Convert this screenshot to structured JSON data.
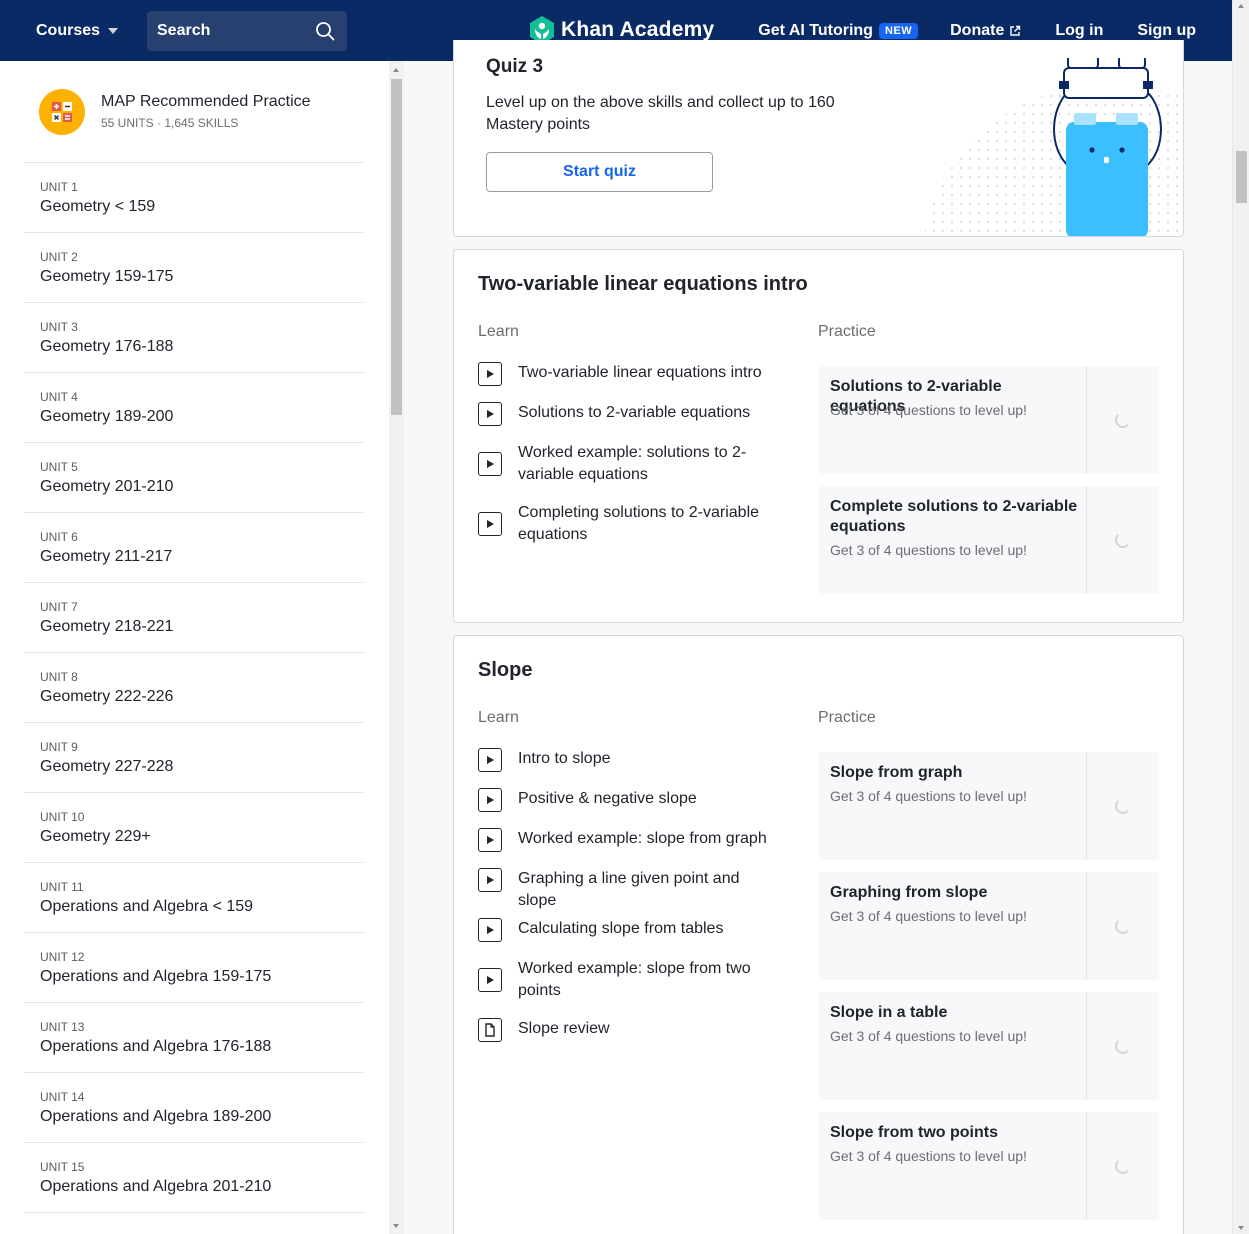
{
  "nav": {
    "courses_label": "Courses",
    "search_label": "Search",
    "logo_text": "Khan Academy",
    "ai_tutoring": "Get AI Tutoring",
    "new_badge": "NEW",
    "donate": "Donate",
    "login": "Log in",
    "signup": "Sign up",
    "colors": {
      "nav_bg": "#0a2a66",
      "accent": "#1865f2",
      "logo_green": "#14bf96"
    }
  },
  "sidebar": {
    "course_title": "MAP Recommended Practice",
    "course_sub": "55 UNITS · 1,645 SKILLS",
    "units": [
      {
        "label": "UNIT 1",
        "name": "Geometry < 159"
      },
      {
        "label": "UNIT 2",
        "name": "Geometry 159-175"
      },
      {
        "label": "UNIT 3",
        "name": "Geometry 176-188"
      },
      {
        "label": "UNIT 4",
        "name": "Geometry 189-200"
      },
      {
        "label": "UNIT 5",
        "name": "Geometry 201-210"
      },
      {
        "label": "UNIT 6",
        "name": "Geometry 211-217"
      },
      {
        "label": "UNIT 7",
        "name": "Geometry 218-221"
      },
      {
        "label": "UNIT 8",
        "name": "Geometry 222-226"
      },
      {
        "label": "UNIT 9",
        "name": "Geometry 227-228"
      },
      {
        "label": "UNIT 10",
        "name": "Geometry 229+"
      },
      {
        "label": "UNIT 11",
        "name": "Operations and Algebra < 159"
      },
      {
        "label": "UNIT 12",
        "name": "Operations and Algebra 159-175"
      },
      {
        "label": "UNIT 13",
        "name": "Operations and Algebra 176-188"
      },
      {
        "label": "UNIT 14",
        "name": "Operations and Algebra 189-200"
      },
      {
        "label": "UNIT 15",
        "name": "Operations and Algebra 201-210"
      }
    ]
  },
  "quiz": {
    "title": "Quiz 3",
    "description": "Level up on the above skills and collect up to 160 Mastery points",
    "button": "Start quiz"
  },
  "sections": {
    "two_var": {
      "title": "Two-variable linear equations intro",
      "learn_label": "Learn",
      "practice_label": "Practice",
      "learn": [
        "Two-variable linear equations intro",
        "Solutions to 2-variable equations",
        "Worked example: solutions to 2-variable equations",
        "Completing solutions to 2-variable equations"
      ],
      "practice": [
        {
          "title": "Solutions to 2-variable equations",
          "sub": "Get 3 of 4 questions to level up!"
        },
        {
          "title": "Complete solutions to 2-variable equations",
          "sub": "Get 3 of 4 questions to level up!"
        }
      ]
    },
    "slope": {
      "title": "Slope",
      "learn_label": "Learn",
      "practice_label": "Practice",
      "learn": [
        "Intro to slope",
        "Positive & negative slope",
        "Worked example: slope from graph",
        "Graphing a line given point and slope",
        "Calculating slope from tables",
        "Worked example: slope from two points",
        "Slope review"
      ],
      "practice": [
        {
          "title": "Slope from graph",
          "sub": "Get 3 of 4 questions to level up!"
        },
        {
          "title": "Graphing from slope",
          "sub": "Get 3 of 4 questions to level up!"
        },
        {
          "title": "Slope in a table",
          "sub": "Get 3 of 4 questions to level up!"
        },
        {
          "title": "Slope from two points",
          "sub": "Get 3 of 4 questions to level up!"
        }
      ]
    }
  }
}
